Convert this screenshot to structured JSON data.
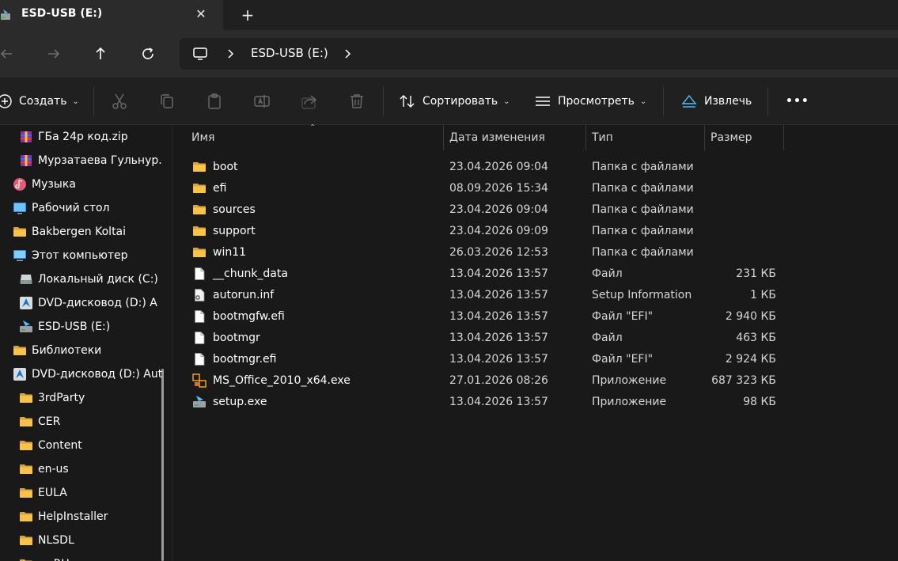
{
  "tab": {
    "title": "ESD-USB (E:)",
    "close": "✕",
    "new_tab": "+"
  },
  "address": {
    "crumb": "ESD-USB (E:)"
  },
  "toolbar": {
    "create": "Создать",
    "sort": "Сортировать",
    "view": "Просмотреть",
    "eject": "Извлечь",
    "more": "•••"
  },
  "sidebar": {
    "items": [
      {
        "label": "ГБа 24р код.zip",
        "icon": "winrar-archive-icon"
      },
      {
        "label": "Мурзатаева Гульнур.",
        "icon": "winrar-archive-icon"
      },
      {
        "label": "Музыка",
        "icon": "music-icon"
      },
      {
        "label": "Рабочий стол",
        "icon": "desktop-icon"
      },
      {
        "label": "Bakbergen Koltai",
        "icon": "folder-icon"
      },
      {
        "label": "Этот компьютер",
        "icon": "computer-icon"
      },
      {
        "label": "Локальный диск (C:)",
        "icon": "drive-icon"
      },
      {
        "label": "DVD-дисковод (D:) A",
        "icon": "autodesk-dvd-icon"
      },
      {
        "label": "ESD-USB (E:)",
        "icon": "usb-drive-icon"
      },
      {
        "label": "Библиотеки",
        "icon": "folder-icon"
      },
      {
        "label": "DVD-дисковод (D:) Aut",
        "icon": "autodesk-dvd-icon"
      },
      {
        "label": "3rdParty",
        "icon": "folder-icon"
      },
      {
        "label": "CER",
        "icon": "folder-icon"
      },
      {
        "label": "Content",
        "icon": "folder-icon"
      },
      {
        "label": "en-us",
        "icon": "folder-icon"
      },
      {
        "label": "EULA",
        "icon": "folder-icon"
      },
      {
        "label": "HelpInstaller",
        "icon": "folder-icon"
      },
      {
        "label": "NLSDL",
        "icon": "folder-icon"
      },
      {
        "label": "ru-RU",
        "icon": "folder-icon"
      }
    ]
  },
  "columns": {
    "name": "Имя",
    "date": "Дата изменения",
    "type": "Тип",
    "size": "Размер"
  },
  "files": [
    {
      "name": "boot",
      "date": "23.04.2026 09:04",
      "type": "Папка с файлами",
      "size": "",
      "icon": "folder-icon"
    },
    {
      "name": "efi",
      "date": "08.09.2026 15:34",
      "type": "Папка с файлами",
      "size": "",
      "icon": "folder-icon"
    },
    {
      "name": "sources",
      "date": "23.04.2026 09:04",
      "type": "Папка с файлами",
      "size": "",
      "icon": "folder-icon"
    },
    {
      "name": "support",
      "date": "23.04.2026 09:09",
      "type": "Папка с файлами",
      "size": "",
      "icon": "folder-icon"
    },
    {
      "name": "win11",
      "date": "26.03.2026 12:53",
      "type": "Папка с файлами",
      "size": "",
      "icon": "folder-icon"
    },
    {
      "name": "__chunk_data",
      "date": "13.04.2026 13:57",
      "type": "Файл",
      "size": "231 КБ",
      "icon": "file-icon"
    },
    {
      "name": "autorun.inf",
      "date": "13.04.2026 13:57",
      "type": "Setup Information",
      "size": "1 КБ",
      "icon": "setup-info-icon"
    },
    {
      "name": "bootmgfw.efi",
      "date": "13.04.2026 13:57",
      "type": "Файл \"EFI\"",
      "size": "2 940 КБ",
      "icon": "file-icon"
    },
    {
      "name": "bootmgr",
      "date": "13.04.2026 13:57",
      "type": "Файл",
      "size": "463 КБ",
      "icon": "file-icon"
    },
    {
      "name": "bootmgr.efi",
      "date": "13.04.2026 13:57",
      "type": "Файл \"EFI\"",
      "size": "2 924 КБ",
      "icon": "file-icon"
    },
    {
      "name": "MS_Office_2010_x64.exe",
      "date": "27.01.2026 08:26",
      "type": "Приложение",
      "size": "687 323 КБ",
      "icon": "office-exe-icon"
    },
    {
      "name": "setup.exe",
      "date": "13.04.2026 13:57",
      "type": "Приложение",
      "size": "98 КБ",
      "icon": "setup-exe-icon"
    }
  ],
  "colors": {
    "folder": "#f8c34a",
    "accent": "#4cc2ff"
  }
}
